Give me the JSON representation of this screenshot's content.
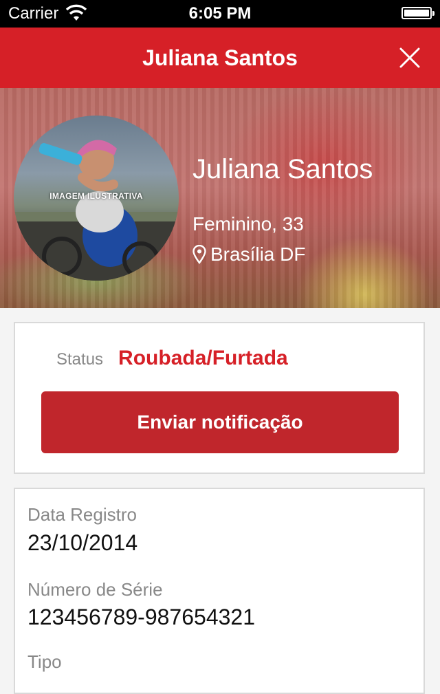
{
  "status_bar": {
    "carrier": "Carrier",
    "time": "6:05 PM"
  },
  "nav": {
    "title": "Juliana Santos",
    "close_icon": "close-icon"
  },
  "profile": {
    "name": "Juliana Santos",
    "gender_age": "Feminino, 33",
    "location": "Brasília DF",
    "avatar_caption": "IMAGEM ILUSTRATIVA"
  },
  "status": {
    "label": "Status",
    "value": "Roubada/Furtada",
    "button_label": "Enviar notificação"
  },
  "details": {
    "fields": [
      {
        "label": "Data Registro",
        "value": "23/10/2014"
      },
      {
        "label": "Número de Série",
        "value": "123456789-987654321"
      },
      {
        "label": "Tipo",
        "value": ""
      }
    ]
  },
  "colors": {
    "brand_red": "#d62027",
    "button_red": "#c0262c"
  }
}
